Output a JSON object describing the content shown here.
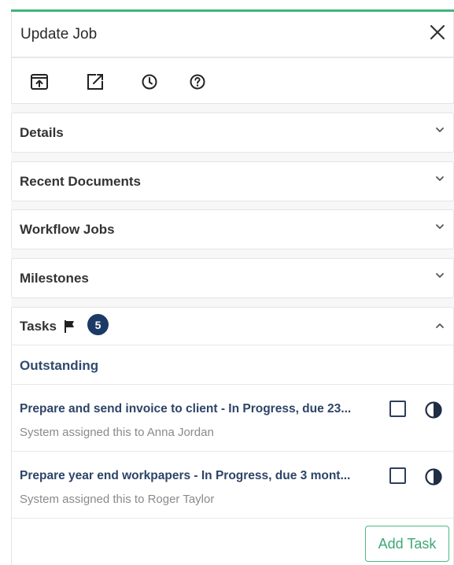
{
  "header": {
    "title": "Update Job"
  },
  "toolbar": {
    "icons": [
      "upload-icon",
      "open-external-icon",
      "clock-icon",
      "help-icon"
    ]
  },
  "sections": [
    {
      "label": "Details",
      "expanded": false
    },
    {
      "label": "Recent Documents",
      "expanded": false
    },
    {
      "label": "Workflow Jobs",
      "expanded": false
    },
    {
      "label": "Milestones",
      "expanded": false
    }
  ],
  "tasks": {
    "label": "Tasks",
    "count": "5",
    "expanded": true,
    "group": "Outstanding",
    "items": [
      {
        "title": "Prepare and send invoice to client - In Progress, due 23...",
        "assigned": "System assigned this to Anna Jordan"
      },
      {
        "title": "Prepare year end workpapers - In Progress, due 3 mont...",
        "assigned": "System assigned this to Roger Taylor"
      }
    ],
    "add_label": "Add Task"
  },
  "colors": {
    "accent": "#3fb67a",
    "badge": "#1b3a66",
    "task_title": "#2d4467"
  }
}
